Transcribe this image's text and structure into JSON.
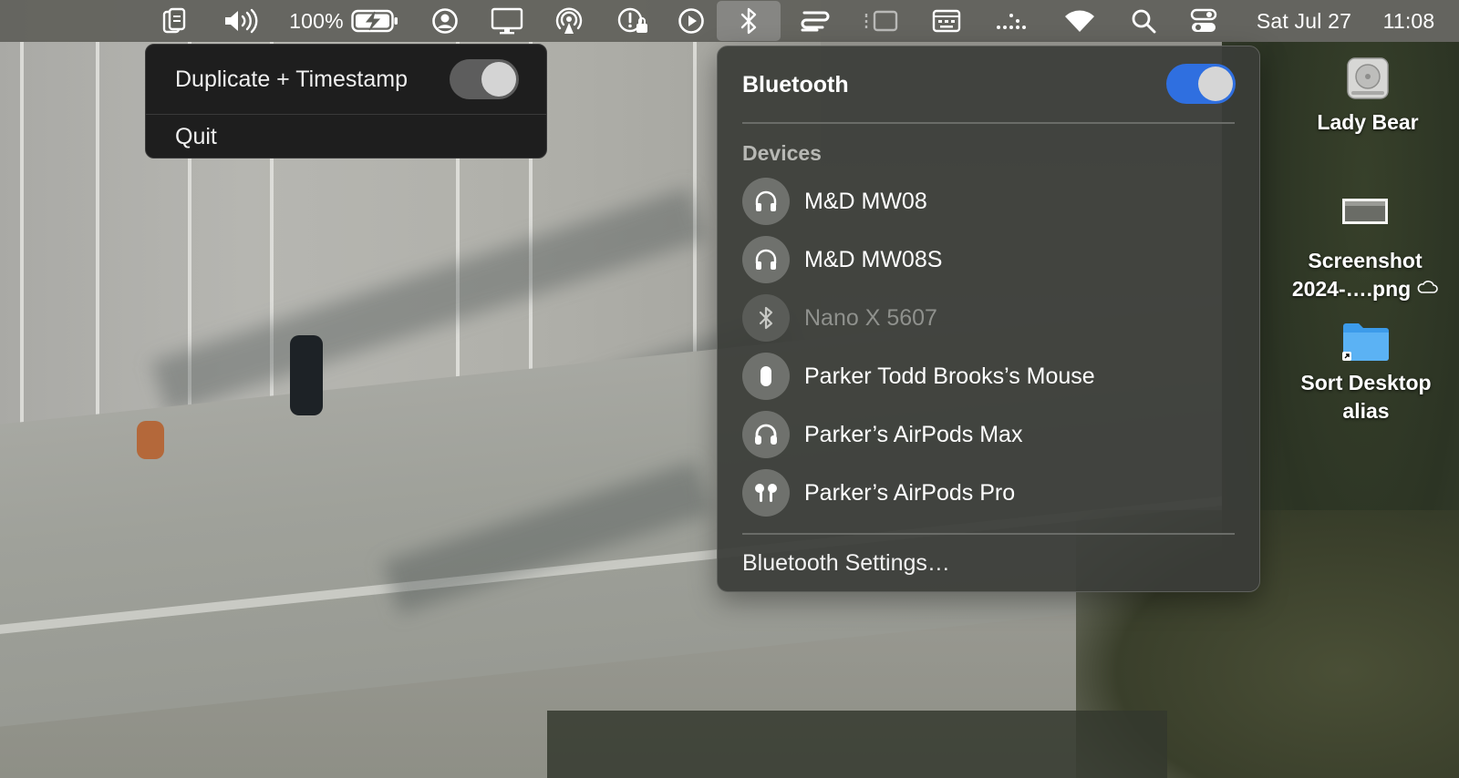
{
  "menubar": {
    "battery_percent": "100%",
    "date": "Sat Jul 27",
    "time": "11:08",
    "icons": [
      "clipboard-icon",
      "volume-icon",
      "battery-icon",
      "user-icon",
      "display-icon",
      "airplay-icon",
      "privacy-icon",
      "play-icon",
      "bluetooth-icon",
      "tailscale-icon",
      "stage-manager-icon",
      "keyboard-viewer-icon",
      "activity-icon",
      "wifi-icon",
      "search-icon",
      "control-center-icon"
    ]
  },
  "app_menu": {
    "duplicate_label": "Duplicate + Timestamp",
    "duplicate_enabled": false,
    "quit_label": "Quit"
  },
  "bluetooth": {
    "title": "Bluetooth",
    "enabled": true,
    "section_label": "Devices",
    "devices": [
      {
        "name": "M&D MW08",
        "icon": "headphones-icon",
        "available": true
      },
      {
        "name": "M&D MW08S",
        "icon": "headphones-icon",
        "available": true
      },
      {
        "name": "Nano X 5607",
        "icon": "bluetooth-icon",
        "available": false
      },
      {
        "name": "Parker Todd Brooks’s Mouse",
        "icon": "mouse-icon",
        "available": true
      },
      {
        "name": "Parker’s AirPods Max",
        "icon": "headphones-icon",
        "available": true
      },
      {
        "name": "Parker’s AirPods Pro",
        "icon": "airpods-icon",
        "available": true
      }
    ],
    "settings_label": "Bluetooth Settings…",
    "accent": "#2f6fe0"
  },
  "desktop": {
    "items": [
      {
        "label": "Lady Bear",
        "icon": "hard-drive-icon"
      },
      {
        "label": "Screenshot 2024-….png",
        "line1": "Screenshot",
        "line2": "2024-….png",
        "icon": "image-file-icon",
        "badge": "icloud-icon"
      },
      {
        "label": "Sort Desktop alias",
        "line1": "Sort Desktop",
        "line2": "alias",
        "icon": "folder-alias-icon"
      }
    ]
  }
}
